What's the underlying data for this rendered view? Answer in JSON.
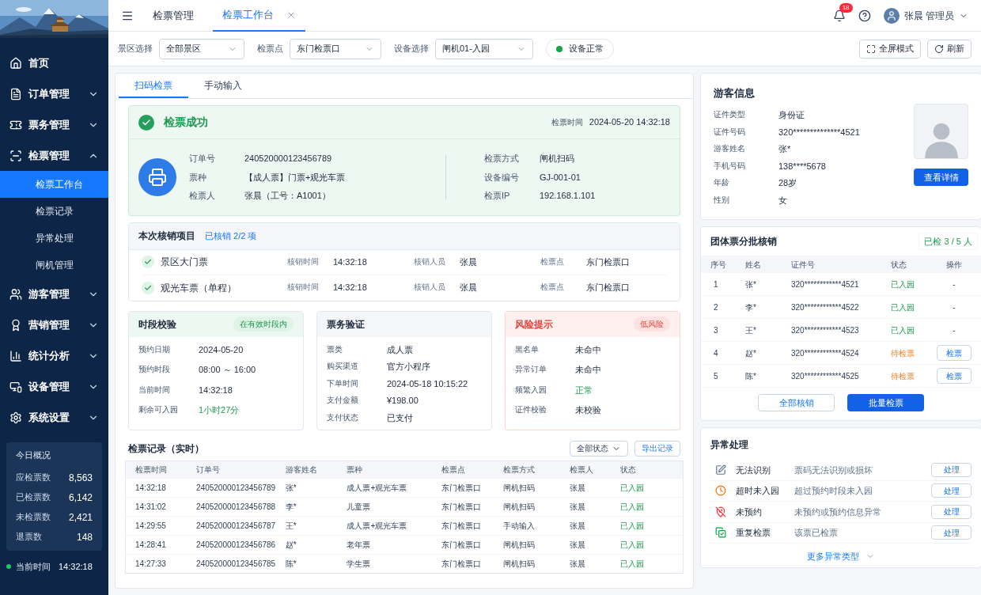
{
  "sidebar": {
    "items": [
      {
        "label": "首页"
      },
      {
        "label": "订单管理",
        "expanded": false
      },
      {
        "label": "票务管理",
        "expanded": false
      },
      {
        "label": "检票管理",
        "expanded": true,
        "children": [
          {
            "label": "检票工作台",
            "selected": true
          },
          {
            "label": "检票记录",
            "selected": false
          },
          {
            "label": "异常处理",
            "selected": false
          },
          {
            "label": "闸机管理",
            "selected": false
          }
        ]
      },
      {
        "label": "游客管理",
        "expanded": false
      },
      {
        "label": "营销管理",
        "expanded": false
      },
      {
        "label": "统计分析",
        "expanded": false
      },
      {
        "label": "设备管理",
        "expanded": false
      },
      {
        "label": "系统设置",
        "expanded": false
      }
    ],
    "today": {
      "title": "今日概况",
      "rows": [
        {
          "label": "应检票数",
          "value": "8,563"
        },
        {
          "label": "已检票数",
          "value": "6,142"
        },
        {
          "label": "未检票数",
          "value": "2,421"
        },
        {
          "label": "退票数",
          "value": "148"
        }
      ]
    },
    "clock": {
      "label": "当前时间",
      "value": "14:32:18"
    }
  },
  "topbar": {
    "breadcrumb": "检票管理",
    "tabs": [
      {
        "label": "检票工作台",
        "selected": true
      }
    ],
    "notifications": "18",
    "user": "张晨 管理员"
  },
  "filters": {
    "selects": [
      {
        "label": "景区选择",
        "value": "全部景区"
      },
      {
        "label": "检票点",
        "value": "东门检票口"
      },
      {
        "label": "设备选择",
        "value": "闸机01-入园"
      }
    ],
    "device_status": "设备正常",
    "buttons": [
      "全屏模式",
      "刷新"
    ]
  },
  "mode_tabs": [
    {
      "label": "扫码检票",
      "selected": true
    },
    {
      "label": "手动输入",
      "selected": false
    }
  ],
  "result": {
    "title": "检票成功",
    "time_label": "检票时间",
    "time": "2024-05-20 14:32:18",
    "left": [
      {
        "label": "订单号",
        "value": "240520000123456789"
      },
      {
        "label": "票种",
        "value": "【成人票】门票+观光车票"
      },
      {
        "label": "检票人",
        "value": "张晨（工号：A1001）"
      }
    ],
    "right": [
      {
        "label": "检票方式",
        "value": "闸机扫码"
      },
      {
        "label": "设备编号",
        "value": "GJ-001-01"
      },
      {
        "label": "检票IP",
        "value": "192.168.1.101"
      }
    ]
  },
  "verification": {
    "title": "本次核销项目",
    "summary": "已核销 2/2 项",
    "items": [
      {
        "name": "景区大门票",
        "checked": true,
        "fields": [
          {
            "label": "核销时间",
            "value": "14:32:18"
          },
          {
            "label": "核销人员",
            "value": "张晨"
          },
          {
            "label": "检票点",
            "value": "东门检票口"
          }
        ]
      },
      {
        "name": "观光车票（单程）",
        "checked": true,
        "fields": [
          {
            "label": "核销时间",
            "value": "14:32:18"
          },
          {
            "label": "核销人员",
            "value": "张晨"
          },
          {
            "label": "检票点",
            "value": "东门检票口"
          }
        ]
      }
    ]
  },
  "cards": [
    {
      "title": "时段校验",
      "badge": "在有效时段内",
      "kind": "success",
      "rows": [
        {
          "label": "预约日期",
          "value": "2024-05-20",
          "kind": "plain"
        },
        {
          "label": "预约时段",
          "value": "08:00 ～ 16:00",
          "kind": "plain"
        },
        {
          "label": "当前时间",
          "value": "14:32:18",
          "kind": "plain"
        },
        {
          "label": "剩余可入园",
          "value": "1小时27分",
          "kind": "positive"
        }
      ]
    },
    {
      "title": "票务验证",
      "kind": "info",
      "rows": [
        {
          "label": "票类",
          "value": "成人票",
          "kind": "plain"
        },
        {
          "label": "购买渠道",
          "value": "官方小程序",
          "kind": "plain"
        },
        {
          "label": "下单时间",
          "value": "2024-05-18 10:15:22",
          "kind": "plain"
        },
        {
          "label": "支付金额",
          "value": "¥198.00",
          "kind": "plain"
        },
        {
          "label": "支付状态",
          "value": "已支付",
          "kind": "plain"
        }
      ]
    },
    {
      "title": "风险提示",
      "badge": "低风险",
      "kind": "danger",
      "rows": [
        {
          "label": "黑名单",
          "value": "未命中",
          "kind": "plain"
        },
        {
          "label": "异常订单",
          "value": "未命中",
          "kind": "plain"
        },
        {
          "label": "频繁入园",
          "value": "正常",
          "kind": "positive"
        },
        {
          "label": "证件校验",
          "value": "未校验",
          "kind": "plain"
        }
      ]
    }
  ],
  "records": {
    "title": "检票记录（实时）",
    "filter": "全部状态",
    "export": "导出记录",
    "columns": [
      "检票时间",
      "订单号",
      "游客姓名",
      "票种",
      "检票点",
      "检票方式",
      "检票人",
      "状态"
    ],
    "rows": [
      [
        "14:32:18",
        "240520000123456789",
        "张*",
        "成人票+观光车票",
        "东门检票口",
        "闸机扫码",
        "张晨",
        "已入园"
      ],
      [
        "14:31:02",
        "240520000123456788",
        "李*",
        "儿童票",
        "东门检票口",
        "闸机扫码",
        "张晨",
        "已入园"
      ],
      [
        "14:29:55",
        "240520000123456787",
        "王*",
        "成人票+观光车票",
        "东门检票口",
        "手动输入",
        "张晨",
        "已入园"
      ],
      [
        "14:28:41",
        "240520000123456786",
        "赵*",
        "老年票",
        "东门检票口",
        "闸机扫码",
        "张晨",
        "已入园"
      ],
      [
        "14:27:33",
        "240520000123456785",
        "陈*",
        "学生票",
        "东门检票口",
        "闸机扫码",
        "张晨",
        "已入园"
      ]
    ]
  },
  "visitor": {
    "title": "游客信息",
    "fields": [
      {
        "label": "证件类型",
        "value": "身份证"
      },
      {
        "label": "证件号码",
        "value": "320**************4521"
      },
      {
        "label": "游客姓名",
        "value": "张*"
      },
      {
        "label": "手机号码",
        "value": "138****5678"
      },
      {
        "label": "年龄",
        "value": "28岁"
      },
      {
        "label": "性别",
        "value": "女"
      }
    ],
    "button": "查看详情"
  },
  "group": {
    "title": "团体票分批核销",
    "badge": "已检 3 / 5 人",
    "columns": [
      "序号",
      "姓名",
      "证件号",
      "状态",
      "操作"
    ],
    "rows": [
      {
        "no": "1",
        "name": "张*",
        "id": "320************4521",
        "status": "已入园",
        "checked": true,
        "action": "-"
      },
      {
        "no": "2",
        "name": "李*",
        "id": "320************4522",
        "status": "已入园",
        "checked": true,
        "action": "-"
      },
      {
        "no": "3",
        "name": "王*",
        "id": "320************4523",
        "status": "已入园",
        "checked": true,
        "action": "-"
      },
      {
        "no": "4",
        "name": "赵*",
        "id": "320************4524",
        "status": "待检票",
        "checked": false,
        "action": "检票"
      },
      {
        "no": "5",
        "name": "陈*",
        "id": "320************4525",
        "status": "待检票",
        "checked": false,
        "action": "检票"
      }
    ],
    "buttons": [
      "全部核销",
      "批量检票"
    ]
  },
  "exceptions": {
    "title": "异常处理",
    "items": [
      {
        "name": "无法识别",
        "desc": "票码无法识别或损坏",
        "action": "处理"
      },
      {
        "name": "超时未入园",
        "desc": "超过预约时段未入园",
        "action": "处理"
      },
      {
        "name": "未预约",
        "desc": "未预约或预约信息异常",
        "action": "处理"
      },
      {
        "name": "重复检票",
        "desc": "该票已检票",
        "action": "处理"
      }
    ],
    "more": "更多异常类型"
  }
}
